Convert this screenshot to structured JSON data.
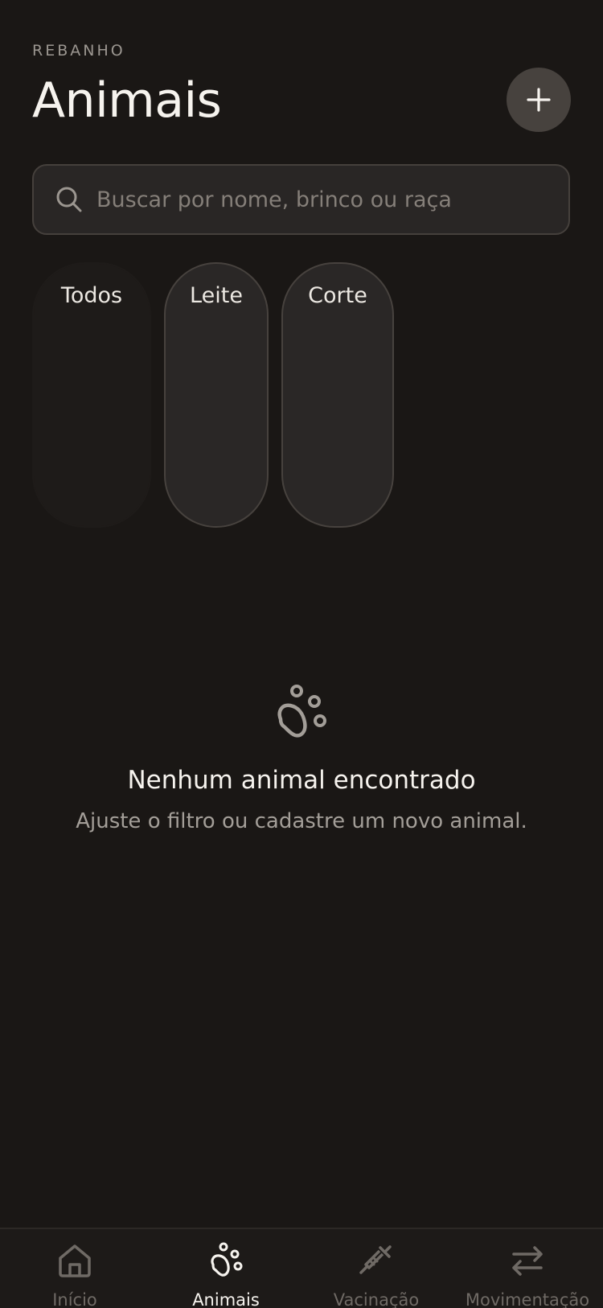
{
  "header": {
    "eyebrow": "REBANHO",
    "title": "Animais",
    "add_icon": "plus-icon"
  },
  "search": {
    "icon": "search-icon",
    "placeholder": "Buscar por nome, brinco ou raça",
    "value": ""
  },
  "filters": [
    {
      "label": "Todos",
      "selected": true
    },
    {
      "label": "Leite",
      "selected": false
    },
    {
      "label": "Corte",
      "selected": false
    }
  ],
  "empty_state": {
    "icon": "paw-icon",
    "title": "Nenhum animal encontrado",
    "subtitle": "Ajuste o filtro ou cadastre um novo animal."
  },
  "tabbar": {
    "items": [
      {
        "label": "Início",
        "icon": "home-icon",
        "active": false
      },
      {
        "label": "Animais",
        "icon": "paw-icon",
        "active": true
      },
      {
        "label": "Vacinação",
        "icon": "syringe-icon",
        "active": false
      },
      {
        "label": "Movimentação",
        "icon": "arrows-swap-icon",
        "active": false
      }
    ]
  },
  "colors": {
    "background": "#1a1715",
    "surface": "#292625",
    "border": "#45403c",
    "text_primary": "#f6f3ee",
    "text_muted": "#a39e98",
    "tab_inactive": "#6f6a65"
  }
}
